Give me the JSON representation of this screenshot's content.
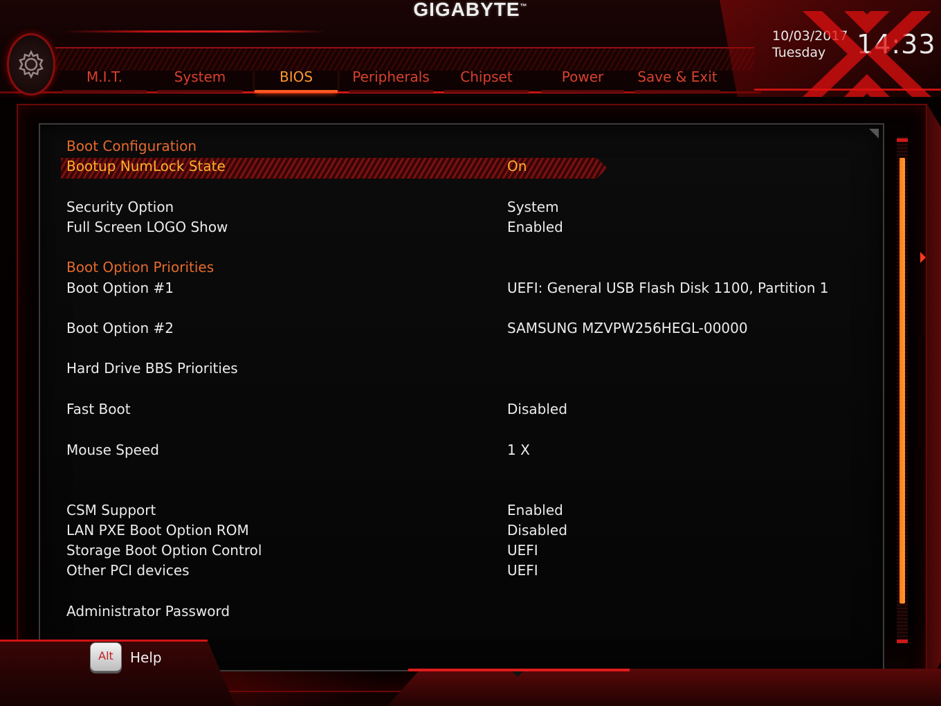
{
  "brand": {
    "logo": "GIGABYTE",
    "trademark": "™"
  },
  "datetime": {
    "date": "10/03/2017",
    "day": "Tuesday",
    "time": "14:33"
  },
  "tabs": [
    {
      "label": "M.I.T.",
      "active": false
    },
    {
      "label": "System",
      "active": false
    },
    {
      "label": "BIOS",
      "active": true
    },
    {
      "label": "Peripherals",
      "active": false
    },
    {
      "label": "Chipset",
      "active": false
    },
    {
      "label": "Power",
      "active": false
    },
    {
      "label": "Save & Exit",
      "active": false
    }
  ],
  "sections": {
    "boot_configuration": "Boot Configuration",
    "boot_option_priorities": "Boot Option Priorities"
  },
  "settings": {
    "bootup_numlock": {
      "label": "Bootup NumLock State",
      "value": "On"
    },
    "security_option": {
      "label": "Security Option",
      "value": "System"
    },
    "full_screen_logo": {
      "label": "Full Screen LOGO Show",
      "value": "Enabled"
    },
    "boot_option_1": {
      "label": "Boot Option #1",
      "value": "UEFI: General USB Flash Disk 1100, Partition 1"
    },
    "boot_option_2": {
      "label": "Boot Option #2",
      "value": "SAMSUNG MZVPW256HEGL-00000"
    },
    "hdd_bbs": {
      "label": "Hard Drive BBS Priorities"
    },
    "fast_boot": {
      "label": "Fast Boot",
      "value": "Disabled"
    },
    "mouse_speed": {
      "label": "Mouse Speed",
      "value": "1 X"
    },
    "csm_support": {
      "label": "CSM Support",
      "value": "Enabled"
    },
    "lan_pxe": {
      "label": "LAN PXE Boot Option ROM",
      "value": "Disabled"
    },
    "storage_boot": {
      "label": "Storage Boot Option Control",
      "value": "UEFI"
    },
    "other_pci": {
      "label": "Other PCI devices",
      "value": "UEFI"
    },
    "admin_password": {
      "label": "Administrator Password"
    }
  },
  "footer": {
    "alt_key": "Alt",
    "help_label": "Help"
  },
  "colors": {
    "accent_red": "#d01515",
    "section_orange": "#e66a2c",
    "selected_yellow": "#ffb02a",
    "active_tab": "#ff9830",
    "text": "#ececec"
  },
  "icons": {
    "settings": "gear-icon",
    "watermark": "watermark-logo"
  }
}
